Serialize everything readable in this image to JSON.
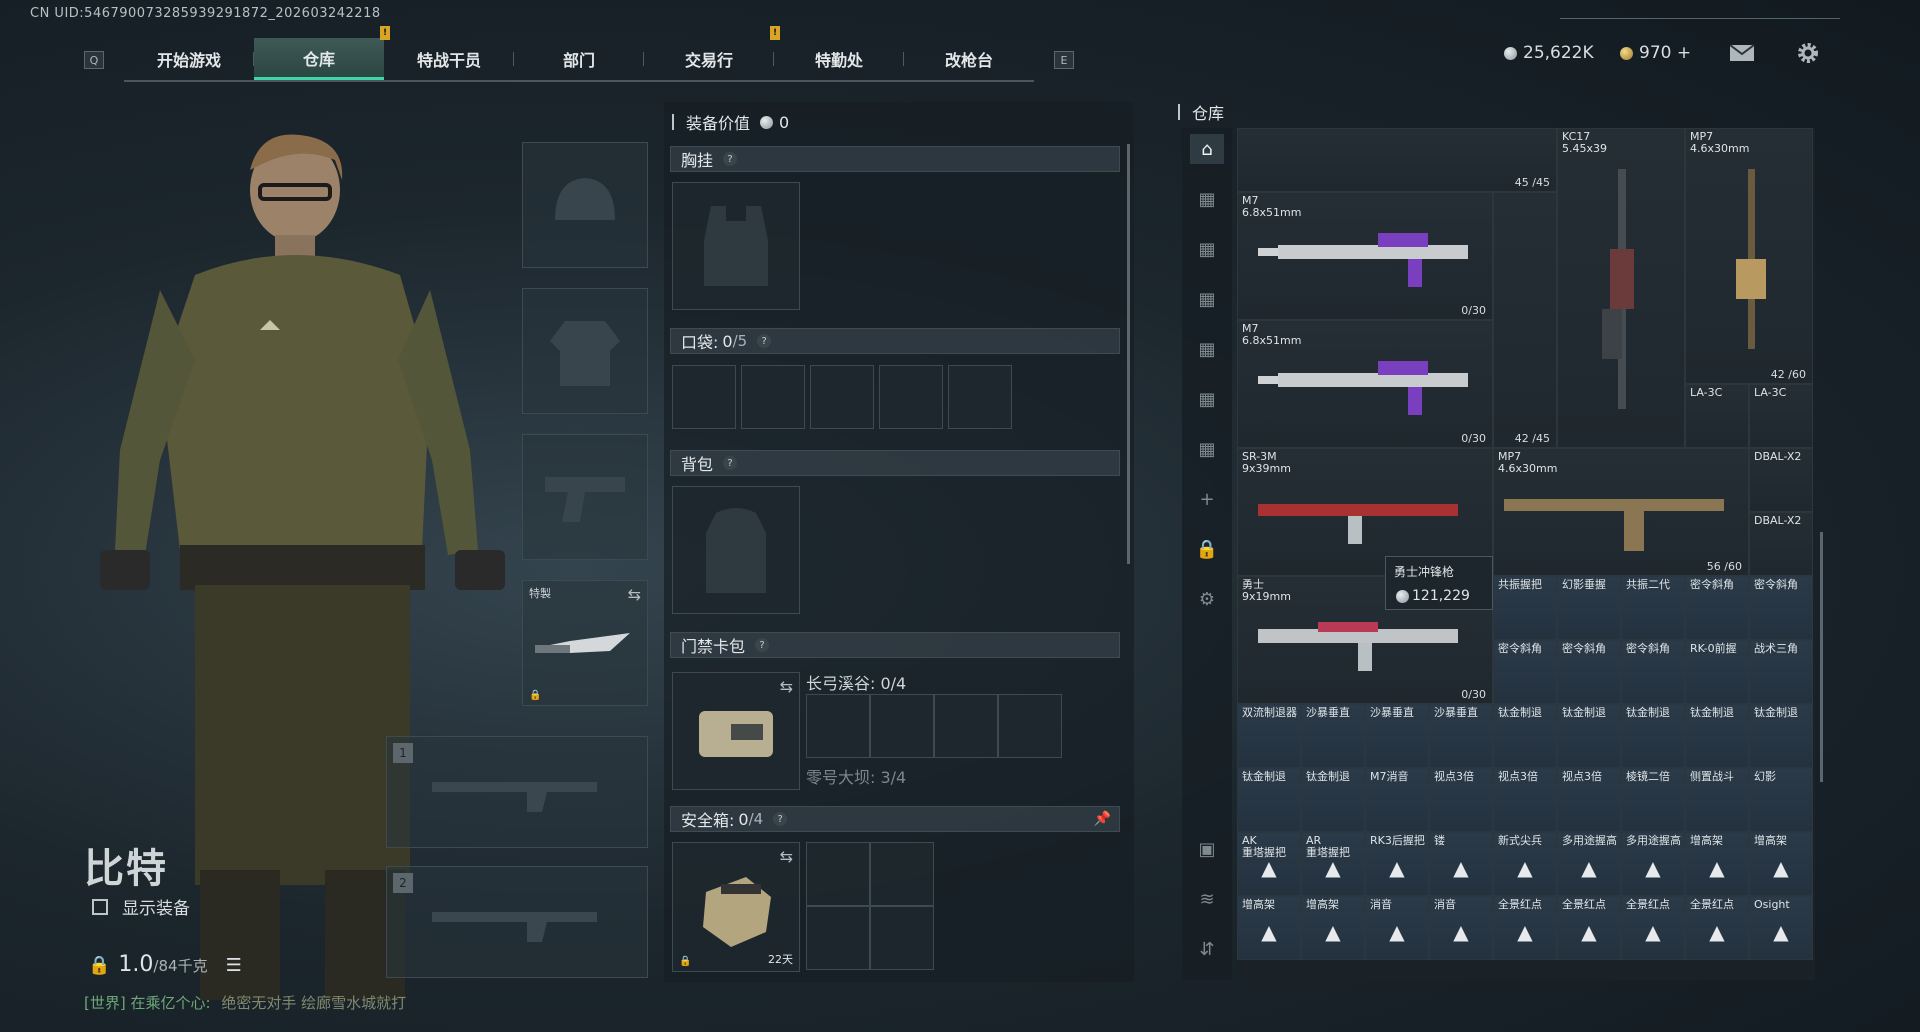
{
  "header": {
    "uid": "CN UID:546790073285939291872_202603242218",
    "left_key": "Q",
    "right_key": "E",
    "tabs": [
      {
        "label": "开始游戏",
        "active": false,
        "alert": false
      },
      {
        "label": "仓库",
        "active": true,
        "alert": true
      },
      {
        "label": "特战干员",
        "active": false,
        "alert": false
      },
      {
        "label": "部门",
        "active": false,
        "alert": false
      },
      {
        "label": "交易行",
        "active": false,
        "alert": true
      },
      {
        "label": "特勤处",
        "active": false,
        "alert": false
      },
      {
        "label": "改枪台",
        "active": false,
        "alert": false
      }
    ],
    "alert_mark": "!",
    "currency_silver": "25,622K",
    "currency_gold": "970 +",
    "icons": {
      "mail": "mail-icon",
      "settings": "gear-icon"
    }
  },
  "character": {
    "name": "比特",
    "show_equipment_label": "显示装备",
    "weight": "1.0",
    "weight_unit": "/84千克",
    "chat_channel": "[世界]",
    "chat_sender": "在乘亿个心:",
    "chat_message": "绝密无对手 绘廊雪水城就打"
  },
  "equip_slots": {
    "melee_label": "特製",
    "primary_num": "1",
    "secondary_num": "2"
  },
  "middle": {
    "value_label": "装备价值",
    "value": "0",
    "chest_label": "胸挂",
    "pocket_label": "口袋:",
    "pocket_count": "0",
    "pocket_max": "/5",
    "backpack_label": "背包",
    "keycard_label": "门禁卡包",
    "key_area_1": "长弓溪谷: 0/4",
    "key_area_2": "零号大坝: 3/4",
    "safebox_label": "安全箱:",
    "safebox_count": "0",
    "safebox_max": "/4",
    "safebox_days": "22天"
  },
  "warehouse": {
    "title": "仓库",
    "tooltip_name": "勇士冲锋枪",
    "tooltip_value": "121,229",
    "items": [
      {
        "name": "",
        "foot": "45 /45"
      },
      {
        "name": "KC17\n5.45x39",
        "foot": ""
      },
      {
        "name": "MP7\n4.6x30mm",
        "foot": "42 /60"
      },
      {
        "name": "M7\n6.8x51mm",
        "foot": "0/30"
      },
      {
        "name": "M7\n6.8x51mm",
        "foot": "0/30"
      },
      {
        "name": "",
        "foot": "42 /45"
      },
      {
        "name": "LA-3C",
        "foot": ""
      },
      {
        "name": "LA-3C",
        "foot": ""
      },
      {
        "name": "SR-3M\n9x39mm",
        "foot": ""
      },
      {
        "name": "MP7\n4.6x30mm",
        "foot": "56 /60"
      },
      {
        "name": "DBAL-X2",
        "foot": ""
      },
      {
        "name": "DBAL-X2",
        "foot": ""
      },
      {
        "name": "勇士\n9x19mm",
        "foot": "0/30"
      },
      {
        "name": "共振握把",
        "foot": ""
      },
      {
        "name": "幻影垂握",
        "foot": ""
      },
      {
        "name": "共振二代",
        "foot": ""
      },
      {
        "name": "密令斜角",
        "foot": ""
      },
      {
        "name": "密令斜角",
        "foot": ""
      },
      {
        "name": "密令斜角",
        "foot": ""
      },
      {
        "name": "密令斜角",
        "foot": ""
      },
      {
        "name": "密令斜角",
        "foot": ""
      },
      {
        "name": "RK-0前握",
        "foot": ""
      },
      {
        "name": "战术三角",
        "foot": ""
      },
      {
        "name": "双流制退器",
        "foot": ""
      },
      {
        "name": "沙暴垂直",
        "foot": ""
      },
      {
        "name": "沙暴垂直",
        "foot": ""
      },
      {
        "name": "沙暴垂直",
        "foot": ""
      },
      {
        "name": "钛金制退",
        "foot": ""
      },
      {
        "name": "钛金制退",
        "foot": ""
      },
      {
        "name": "钛金制退",
        "foot": ""
      },
      {
        "name": "钛金制退",
        "foot": ""
      },
      {
        "name": "钛金制退",
        "foot": ""
      },
      {
        "name": "钛金制退",
        "foot": ""
      },
      {
        "name": "钛金制退",
        "foot": ""
      },
      {
        "name": "M7消音",
        "foot": ""
      },
      {
        "name": "视点3倍",
        "foot": ""
      },
      {
        "name": "视点3倍",
        "foot": ""
      },
      {
        "name": "视点3倍",
        "foot": ""
      },
      {
        "name": "棱镜二倍",
        "foot": ""
      },
      {
        "name": "侧置战斗",
        "foot": ""
      },
      {
        "name": "幻影",
        "foot": ""
      },
      {
        "name": "AK\n重塔握把",
        "foot": ""
      },
      {
        "name": "AR\n重塔握把",
        "foot": ""
      },
      {
        "name": "RK3后握把",
        "foot": ""
      },
      {
        "name": "镂",
        "foot": ""
      },
      {
        "name": "新式尖兵",
        "foot": ""
      },
      {
        "name": "多用途握高",
        "foot": ""
      },
      {
        "name": "多用途握高",
        "foot": ""
      },
      {
        "name": "增高架",
        "foot": ""
      },
      {
        "name": "增高架",
        "foot": ""
      },
      {
        "name": "增高架",
        "foot": ""
      },
      {
        "name": "增高架",
        "foot": ""
      },
      {
        "name": "消音",
        "foot": ""
      },
      {
        "name": "消音",
        "foot": ""
      },
      {
        "name": "全景红点",
        "foot": ""
      },
      {
        "name": "全景红点",
        "foot": ""
      },
      {
        "name": "全景红点",
        "foot": ""
      },
      {
        "name": "全景红点",
        "foot": ""
      },
      {
        "name": "Osight",
        "foot": ""
      }
    ]
  }
}
